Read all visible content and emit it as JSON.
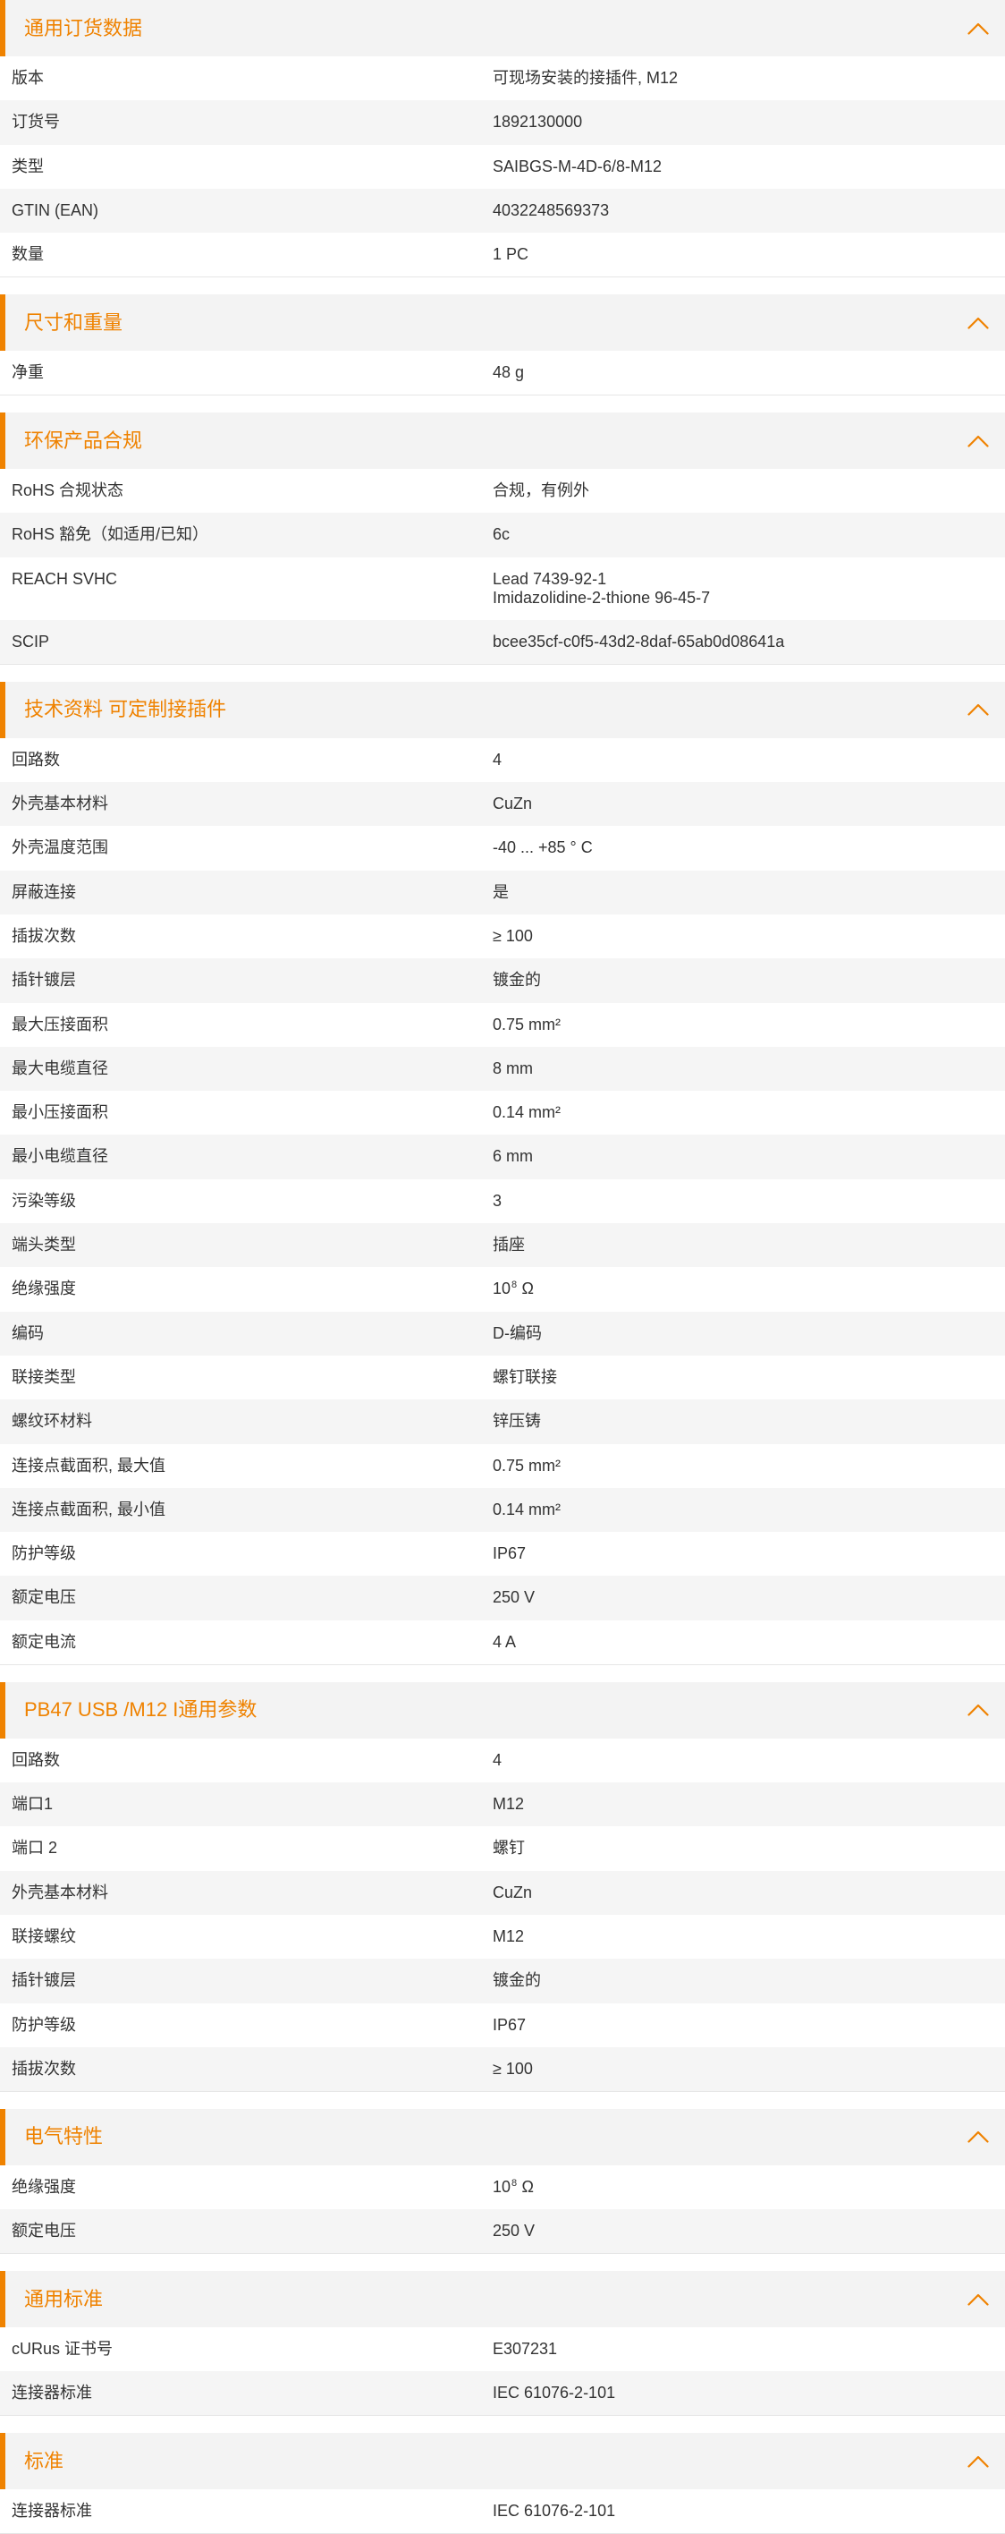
{
  "theme": {
    "accent": "#ef8200",
    "header_bg": "#f3f3f3",
    "row_alt": "#f5f5f5",
    "text": "#333333"
  },
  "icons": {
    "section_toggle": "chevron-up-icon"
  },
  "sections": [
    {
      "title": "通用订货数据",
      "rows": [
        {
          "label": "版本",
          "value": "可现场安装的接插件, M12"
        },
        {
          "label": "订货号",
          "value": "1892130000"
        },
        {
          "label": "类型",
          "value": "SAIBGS-M-4D-6/8-M12"
        },
        {
          "label": "GTIN (EAN)",
          "value": "4032248569373"
        },
        {
          "label": "数量",
          "value": "1 PC"
        }
      ]
    },
    {
      "title": "尺寸和重量",
      "rows": [
        {
          "label": "净重",
          "value": "48 g"
        }
      ]
    },
    {
      "title": "环保产品合规",
      "rows": [
        {
          "label": "RoHS 合规状态",
          "value": "合规，有例外"
        },
        {
          "label": "RoHS 豁免（如适用/已知）",
          "value": "6c"
        },
        {
          "label": "REACH SVHC",
          "value_lines": [
            "Lead 7439-92-1",
            "Imidazolidine-2-thione 96-45-7"
          ]
        },
        {
          "label": "SCIP",
          "value": "bcee35cf-c0f5-43d2-8daf-65ab0d08641a"
        }
      ]
    },
    {
      "title": "技术资料 可定制接插件",
      "rows": [
        {
          "label": "回路数",
          "value": "4"
        },
        {
          "label": "外壳基本材料",
          "value": "CuZn"
        },
        {
          "label": "外壳温度范围",
          "value": "-40 ... +85 ° C"
        },
        {
          "label": "屏蔽连接",
          "value": "是"
        },
        {
          "label": "插拔次数",
          "value": "≥ 100"
        },
        {
          "label": "插针镀层",
          "value": "镀金的"
        },
        {
          "label": "最大压接面积",
          "value": "0.75 mm²"
        },
        {
          "label": "最大电缆直径",
          "value": "8 mm"
        },
        {
          "label": "最小压接面积",
          "value": "0.14 mm²"
        },
        {
          "label": "最小电缆直径",
          "value": "6 mm"
        },
        {
          "label": "污染等级",
          "value": "3"
        },
        {
          "label": "端头类型",
          "value": "插座"
        },
        {
          "label": "绝缘强度",
          "value": "10",
          "value_sup": "8",
          "value_unit": "Ω"
        },
        {
          "label": "编码",
          "value": "D-编码"
        },
        {
          "label": "联接类型",
          "value": "螺钉联接"
        },
        {
          "label": "螺纹环材料",
          "value": "锌压铸"
        },
        {
          "label": "连接点截面积, 最大值",
          "value": "0.75 mm²"
        },
        {
          "label": "连接点截面积, 最小值",
          "value": "0.14 mm²"
        },
        {
          "label": "防护等级",
          "value": "IP67"
        },
        {
          "label": "额定电压",
          "value": "250 V"
        },
        {
          "label": "额定电流",
          "value": "4 A"
        }
      ]
    },
    {
      "title": "PB47 USB /M12 I通用参数",
      "rows": [
        {
          "label": "回路数",
          "value": "4"
        },
        {
          "label": "端口1",
          "value": "M12"
        },
        {
          "label": "端口 2",
          "value": "螺钉"
        },
        {
          "label": "外壳基本材料",
          "value": "CuZn"
        },
        {
          "label": "联接螺纹",
          "value": "M12"
        },
        {
          "label": "插针镀层",
          "value": "镀金的"
        },
        {
          "label": "防护等级",
          "value": "IP67"
        },
        {
          "label": "插拔次数",
          "value": "≥ 100"
        }
      ]
    },
    {
      "title": "电气特性",
      "rows": [
        {
          "label": "绝缘强度",
          "value": "10",
          "value_sup": "8",
          "value_unit": "Ω"
        },
        {
          "label": "额定电压",
          "value": "250 V"
        }
      ]
    },
    {
      "title": "通用标准",
      "rows": [
        {
          "label": "cURus 证书号",
          "value": "E307231"
        },
        {
          "label": "连接器标准",
          "value": "IEC 61076-2-101"
        }
      ]
    },
    {
      "title": "标准",
      "rows": [
        {
          "label": "连接器标准",
          "value": "IEC 61076-2-101"
        }
      ]
    }
  ]
}
